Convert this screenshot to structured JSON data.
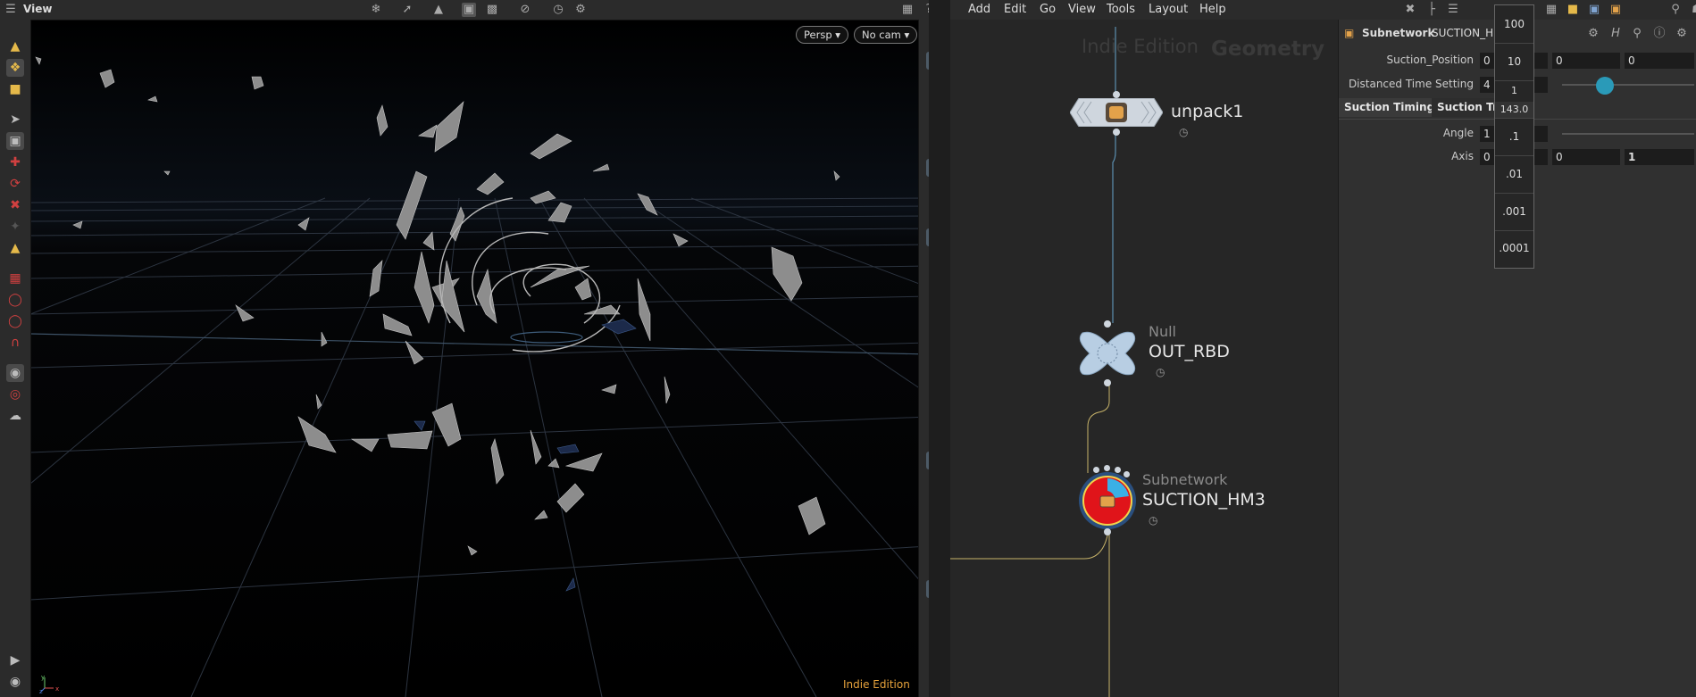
{
  "viewport": {
    "title": "View",
    "persp_label": "Persp ▾",
    "cam_label": "No cam ▾",
    "edition_badge": "Indie Edition",
    "axis_labels": {
      "y": "y",
      "z": "z",
      "x": "x"
    }
  },
  "menubar": [
    "Add",
    "Edit",
    "Go",
    "View",
    "Tools",
    "Layout",
    "Help"
  ],
  "network": {
    "watermark_edition": "Indie Edition",
    "watermark_context": "Geometry",
    "nodes": [
      {
        "type": "",
        "name": "unpack1"
      },
      {
        "type": "Null",
        "name": "OUT_RBD"
      },
      {
        "type": "Subnetwork",
        "name": "SUCTION_HM3"
      }
    ]
  },
  "params": {
    "header_type": "Subnetwork",
    "header_name": "SUCTION_H",
    "rows": {
      "suction_position": {
        "label": "Suction_Position",
        "values": [
          "0",
          "0",
          "0"
        ]
      },
      "distanced_time": {
        "label": "Distanced Time Setting",
        "value": "4"
      },
      "angle": {
        "label": "Angle",
        "value": "1"
      },
      "axis": {
        "label": "Axis",
        "values": [
          "0",
          "0",
          "1"
        ]
      }
    },
    "tabs": [
      "Suction Timing",
      "Suction Tra"
    ]
  },
  "ladder": [
    "100",
    "10",
    "1",
    "143.0",
    ".1",
    ".01",
    ".001",
    ".0001"
  ],
  "colors": {
    "accent_orange": "#e8a33c",
    "node_red": "#e0141a",
    "wire_blue": "#5b8fb0",
    "wire_yellow": "#c8b46a"
  }
}
